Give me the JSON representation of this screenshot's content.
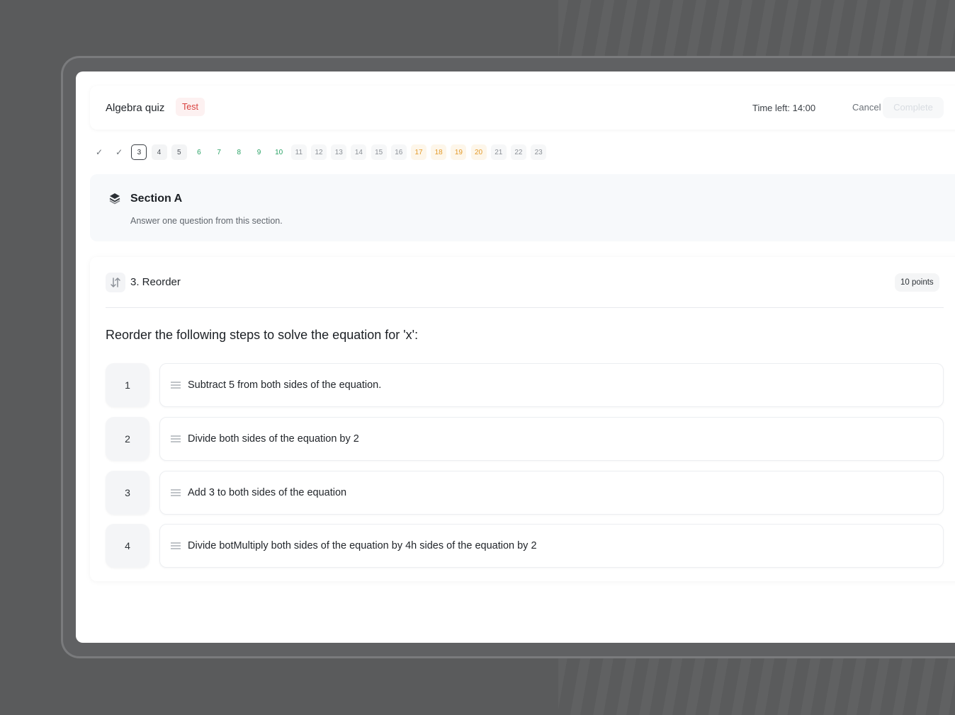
{
  "header": {
    "quiz_title": "Algebra quiz",
    "badge": "Test",
    "time_left": "Time left: 14:00",
    "cancel_label": "Cancel",
    "complete_label": "Complete"
  },
  "question_nav": [
    {
      "label": "✓",
      "state": "done"
    },
    {
      "label": "✓",
      "state": "done"
    },
    {
      "label": "3",
      "state": "current"
    },
    {
      "label": "4",
      "state": "neutral"
    },
    {
      "label": "5",
      "state": "neutral"
    },
    {
      "label": "6",
      "state": "green"
    },
    {
      "label": "7",
      "state": "green"
    },
    {
      "label": "8",
      "state": "green"
    },
    {
      "label": "9",
      "state": "green"
    },
    {
      "label": "10",
      "state": "green"
    },
    {
      "label": "11",
      "state": "plain"
    },
    {
      "label": "12",
      "state": "plain"
    },
    {
      "label": "13",
      "state": "plain"
    },
    {
      "label": "14",
      "state": "plain"
    },
    {
      "label": "15",
      "state": "plain"
    },
    {
      "label": "16",
      "state": "plain"
    },
    {
      "label": "17",
      "state": "orange"
    },
    {
      "label": "18",
      "state": "orange"
    },
    {
      "label": "19",
      "state": "orange"
    },
    {
      "label": "20",
      "state": "orange"
    },
    {
      "label": "21",
      "state": "plain"
    },
    {
      "label": "22",
      "state": "plain"
    },
    {
      "label": "23",
      "state": "plain"
    }
  ],
  "section": {
    "icon": "layers-icon",
    "title": "Section A",
    "subtitle": "Answer one question from this section."
  },
  "question": {
    "icon": "sort-arrows-icon",
    "title": "3. Reorder",
    "points": "10 points",
    "prompt": "Reorder the following steps to solve the equation for 'x':",
    "steps": [
      {
        "number": "1",
        "text": "Subtract 5 from both sides of the equation."
      },
      {
        "number": "2",
        "text": "Divide both sides of the equation by 2"
      },
      {
        "number": "3",
        "text": "Add 3 to both sides of the equation"
      },
      {
        "number": "4",
        "text": "Divide botMultiply both sides of the equation by 4h sides of the equation by 2"
      }
    ]
  },
  "colors": {
    "badge_red": "#d9413e",
    "answered_green": "#2aa366",
    "flagged_orange": "#e39a2a",
    "section_bg": "#f7f9fb"
  }
}
